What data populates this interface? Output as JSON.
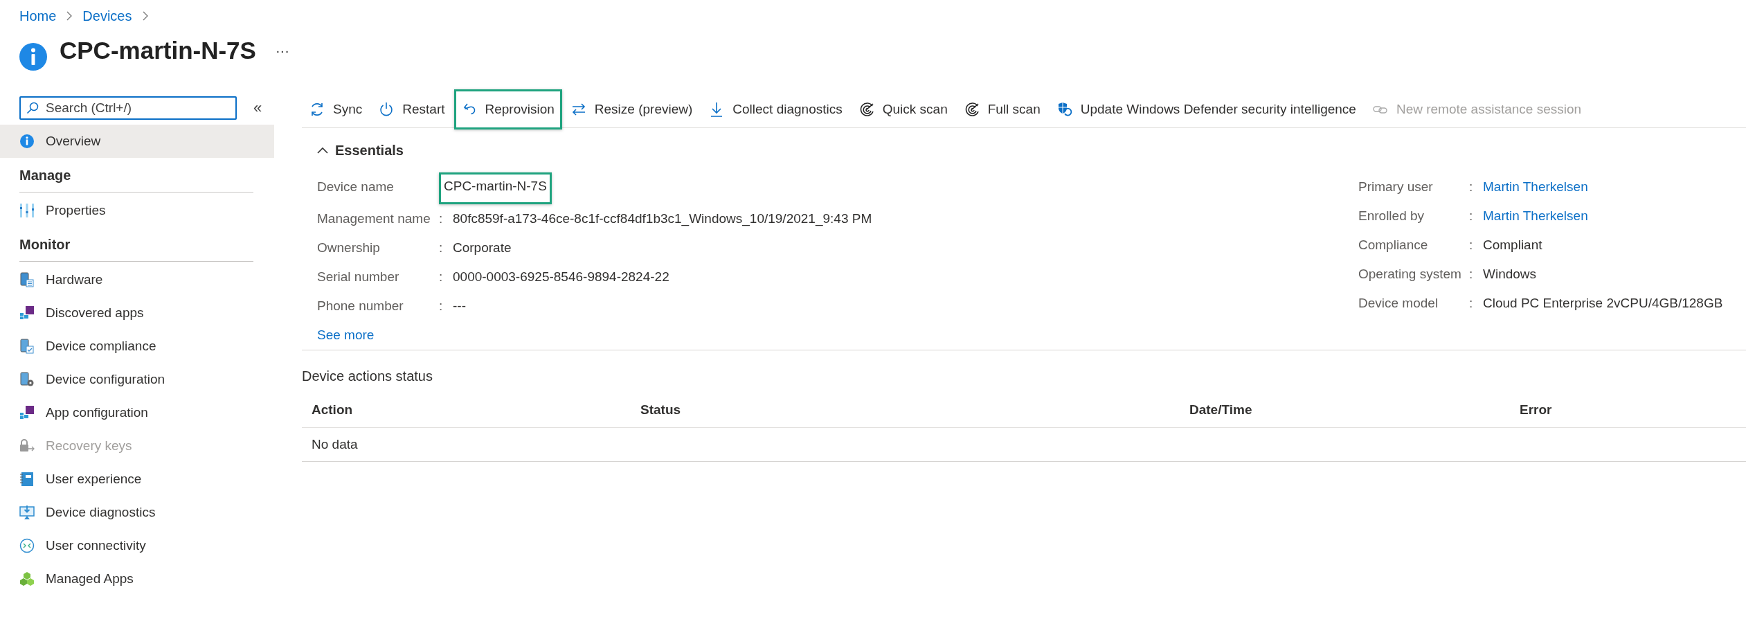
{
  "breadcrumb": [
    {
      "label": "Home"
    },
    {
      "label": "Devices"
    }
  ],
  "title": "CPC-martin-N-7S",
  "title_menu": "···",
  "sidebar": {
    "search": {
      "placeholder": "Search (Ctrl+/)"
    },
    "collapse": "«",
    "items": [
      {
        "label": "Overview",
        "kind": "info",
        "selected": true,
        "disabled": false
      }
    ],
    "sections": [
      {
        "title": "Manage",
        "items": [
          {
            "label": "Properties",
            "kind": "sliders",
            "selected": false,
            "disabled": false
          }
        ]
      },
      {
        "title": "Monitor",
        "items": [
          {
            "label": "Hardware",
            "kind": "device-list",
            "selected": false,
            "disabled": false
          },
          {
            "label": "Discovered apps",
            "kind": "apps",
            "selected": false,
            "disabled": false
          },
          {
            "label": "Device compliance",
            "kind": "device-check",
            "selected": false,
            "disabled": false
          },
          {
            "label": "Device configuration",
            "kind": "device-gear",
            "selected": false,
            "disabled": false
          },
          {
            "label": "App configuration",
            "kind": "apps",
            "selected": false,
            "disabled": false
          },
          {
            "label": "Recovery keys",
            "kind": "lock",
            "selected": false,
            "disabled": true
          },
          {
            "label": "User experience",
            "kind": "notebook",
            "selected": false,
            "disabled": false
          },
          {
            "label": "Device diagnostics",
            "kind": "monitor",
            "selected": false,
            "disabled": false
          },
          {
            "label": "User connectivity",
            "kind": "connect",
            "selected": false,
            "disabled": false
          },
          {
            "label": "Managed Apps",
            "kind": "cubes",
            "selected": false,
            "disabled": false
          }
        ]
      }
    ]
  },
  "toolbar": [
    {
      "label": "Sync",
      "kind": "sync",
      "disabled": false,
      "highlighted": false
    },
    {
      "label": "Restart",
      "kind": "power",
      "disabled": false,
      "highlighted": false
    },
    {
      "label": "Reprovision",
      "kind": "undo",
      "disabled": false,
      "highlighted": true
    },
    {
      "label": "Resize (preview)",
      "kind": "swap",
      "disabled": false,
      "highlighted": false
    },
    {
      "label": "Collect diagnostics",
      "kind": "download",
      "disabled": false,
      "highlighted": false
    },
    {
      "label": "Quick scan",
      "kind": "scan",
      "disabled": false,
      "highlighted": false
    },
    {
      "label": "Full scan",
      "kind": "scan",
      "disabled": false,
      "highlighted": false
    },
    {
      "label": "Update Windows Defender security intelligence",
      "kind": "shield",
      "disabled": false,
      "highlighted": false
    },
    {
      "label": "New remote assistance session",
      "kind": "link",
      "disabled": true,
      "highlighted": false
    }
  ],
  "essentials": {
    "title": "Essentials",
    "expanded": true,
    "left": [
      {
        "label": "Device name",
        "value": "CPC-martin-N-7S",
        "kind": "text",
        "highlighted": true
      },
      {
        "label": "Management name",
        "separator": ":",
        "value": "80fc859f-a173-46ce-8c1f-ccf84df1b3c1_Windows_10/19/2021_9:43 PM",
        "kind": "text",
        "highlighted": false
      },
      {
        "label": "Ownership",
        "separator": ":",
        "value": "Corporate",
        "kind": "text",
        "highlighted": false
      },
      {
        "label": "Serial number",
        "separator": ":",
        "value": "0000-0003-6925-8546-9894-2824-22",
        "kind": "text",
        "highlighted": false
      },
      {
        "label": "Phone number",
        "separator": ":",
        "value": "---",
        "kind": "text",
        "highlighted": false
      }
    ],
    "right": [
      {
        "label": "Primary user",
        "separator": ":",
        "value": "Martin Therkelsen",
        "kind": "link",
        "highlighted": false
      },
      {
        "label": "Enrolled by",
        "separator": ":",
        "value": "Martin Therkelsen",
        "kind": "link",
        "highlighted": false
      },
      {
        "label": "Compliance",
        "separator": ":",
        "value": "Compliant",
        "kind": "text",
        "highlighted": false
      },
      {
        "label": "Operating system",
        "separator": ":",
        "value": "Windows",
        "kind": "text",
        "highlighted": false
      },
      {
        "label": "Device model",
        "separator": ":",
        "value": "Cloud PC Enterprise 2vCPU/4GB/128GB",
        "kind": "text",
        "highlighted": false
      }
    ],
    "see_more": "See more"
  },
  "actions": {
    "title": "Device actions status",
    "columns": [
      "Action",
      "Status",
      "Date/Time",
      "Error"
    ],
    "empty_text": "No data"
  }
}
